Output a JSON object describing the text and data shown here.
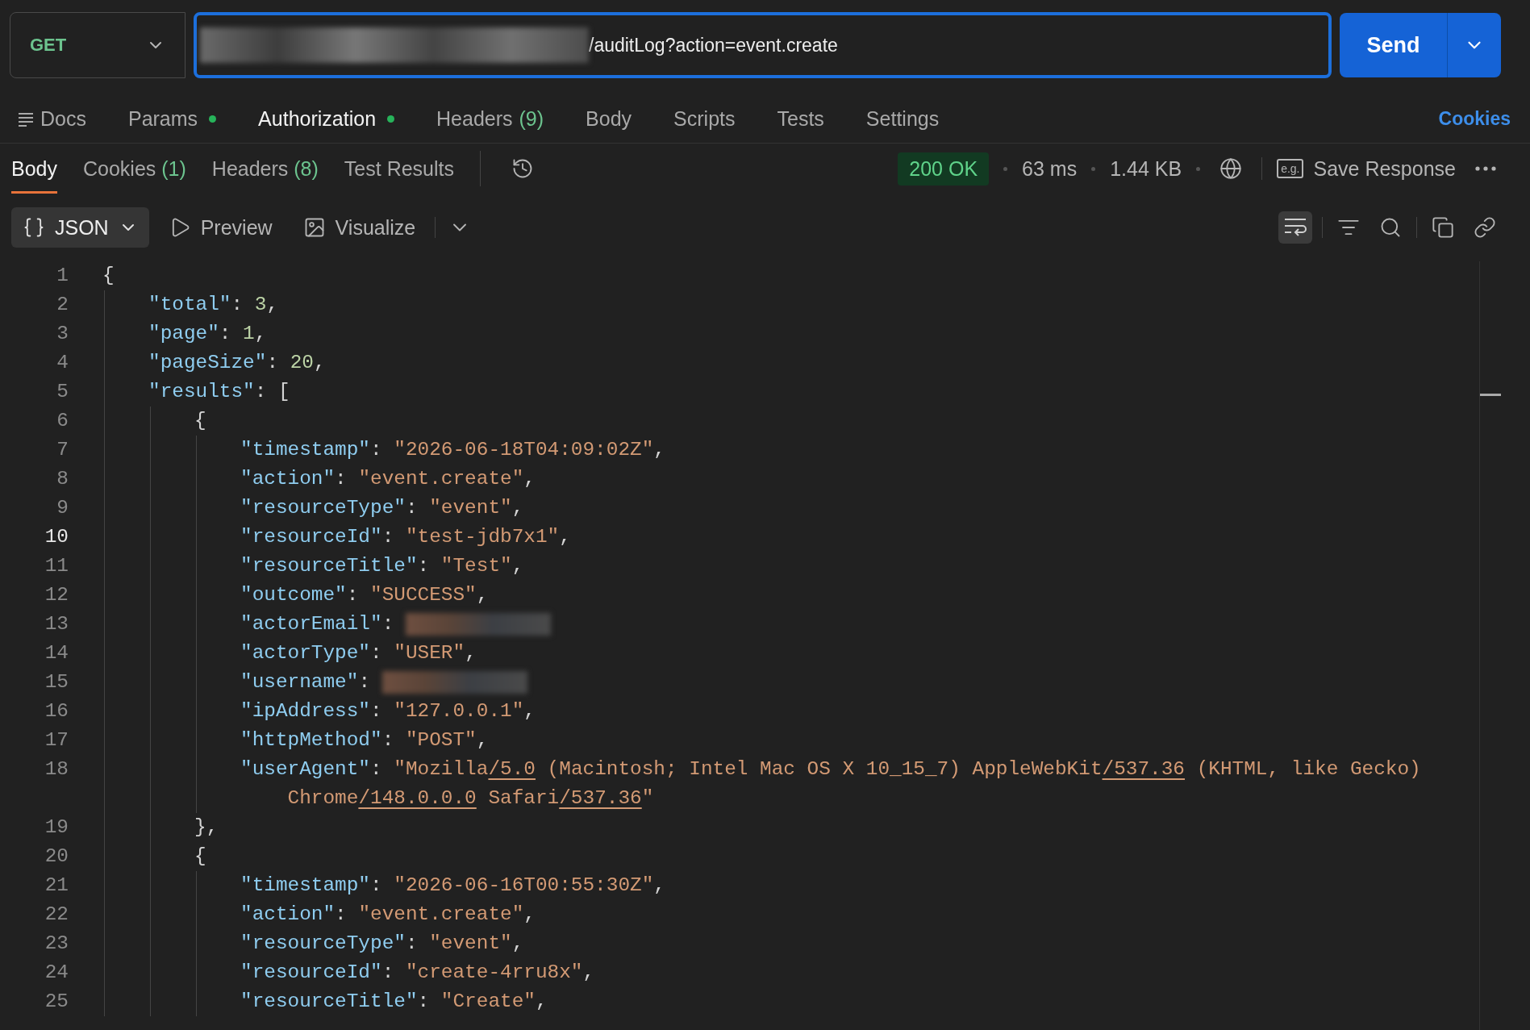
{
  "request": {
    "method": "GET",
    "url": "/auditLog?action=event.create",
    "send": "Send"
  },
  "request_tabs": [
    {
      "label": "Docs",
      "kind": "docs",
      "dot": false,
      "selected": false
    },
    {
      "label": "Params",
      "kind": "plain",
      "dot": true,
      "selected": false
    },
    {
      "label": "Authorization",
      "kind": "plain",
      "dot": true,
      "selected": true
    },
    {
      "label": "Headers",
      "kind": "plain",
      "count": "(9)",
      "dot": false,
      "selected": false
    },
    {
      "label": "Body",
      "kind": "plain",
      "dot": false,
      "selected": false
    },
    {
      "label": "Scripts",
      "kind": "plain",
      "dot": false,
      "selected": false
    },
    {
      "label": "Tests",
      "kind": "plain",
      "dot": false,
      "selected": false
    },
    {
      "label": "Settings",
      "kind": "plain",
      "dot": false,
      "selected": false
    }
  ],
  "cookies_link": "Cookies",
  "response_tabs": [
    {
      "label": "Body",
      "selected": true
    },
    {
      "label": "Cookies",
      "count": "(1)",
      "selected": false
    },
    {
      "label": "Headers",
      "count": "(8)",
      "selected": false
    },
    {
      "label": "Test Results",
      "selected": false
    }
  ],
  "response_meta": {
    "status": "200 OK",
    "time": "63 ms",
    "size": "1.44 KB",
    "example_badge": "e.g.",
    "save": "Save Response"
  },
  "toolbar": {
    "format": "JSON",
    "preview": "Preview",
    "visualize": "Visualize",
    "wrap_on": true
  },
  "code_lines": [
    {
      "number": "1",
      "current": false,
      "tokens": [
        {
          "kind": "punct",
          "text": "{"
        }
      ],
      "children": [
        {
          "number": "2",
          "current": false,
          "tokens": [
            {
              "kind": "key",
              "text": "\"total\""
            },
            {
              "kind": "punct",
              "text": ": "
            },
            {
              "kind": "number",
              "text": "3"
            },
            {
              "kind": "punct",
              "text": ","
            }
          ]
        },
        {
          "number": "3",
          "current": false,
          "tokens": [
            {
              "kind": "key",
              "text": "\"page\""
            },
            {
              "kind": "punct",
              "text": ": "
            },
            {
              "kind": "number",
              "text": "1"
            },
            {
              "kind": "punct",
              "text": ","
            }
          ]
        },
        {
          "number": "4",
          "current": false,
          "tokens": [
            {
              "kind": "key",
              "text": "\"pageSize\""
            },
            {
              "kind": "punct",
              "text": ": "
            },
            {
              "kind": "number",
              "text": "20"
            },
            {
              "kind": "punct",
              "text": ","
            }
          ]
        },
        {
          "number": "5",
          "current": false,
          "tokens": [
            {
              "kind": "key",
              "text": "\"results\""
            },
            {
              "kind": "punct",
              "text": ": ["
            }
          ],
          "children": [
            {
              "number": "6",
              "current": false,
              "tokens": [
                {
                  "kind": "punct",
                  "text": "{"
                }
              ],
              "children": [
                {
                  "number": "7",
                  "current": false,
                  "tokens": [
                    {
                      "kind": "key",
                      "text": "\"timestamp\""
                    },
                    {
                      "kind": "punct",
                      "text": ": "
                    },
                    {
                      "kind": "string",
                      "text": "\"2026-06-18T04:09:02Z\""
                    },
                    {
                      "kind": "punct",
                      "text": ","
                    }
                  ]
                },
                {
                  "number": "8",
                  "current": false,
                  "tokens": [
                    {
                      "kind": "key",
                      "text": "\"action\""
                    },
                    {
                      "kind": "punct",
                      "text": ": "
                    },
                    {
                      "kind": "string",
                      "text": "\"event.create\""
                    },
                    {
                      "kind": "punct",
                      "text": ","
                    }
                  ]
                },
                {
                  "number": "9",
                  "current": false,
                  "tokens": [
                    {
                      "kind": "key",
                      "text": "\"resourceType\""
                    },
                    {
                      "kind": "punct",
                      "text": ": "
                    },
                    {
                      "kind": "string",
                      "text": "\"event\""
                    },
                    {
                      "kind": "punct",
                      "text": ","
                    }
                  ]
                },
                {
                  "number": "10",
                  "current": true,
                  "tokens": [
                    {
                      "kind": "key",
                      "text": "\"resourceId\""
                    },
                    {
                      "kind": "punct",
                      "text": ": "
                    },
                    {
                      "kind": "string",
                      "text": "\"test-jdb7x1\""
                    },
                    {
                      "kind": "punct",
                      "text": ","
                    }
                  ]
                },
                {
                  "number": "11",
                  "current": false,
                  "tokens": [
                    {
                      "kind": "key",
                      "text": "\"resourceTitle\""
                    },
                    {
                      "kind": "punct",
                      "text": ": "
                    },
                    {
                      "kind": "string",
                      "text": "\"Test\""
                    },
                    {
                      "kind": "punct",
                      "text": ","
                    }
                  ]
                },
                {
                  "number": "12",
                  "current": false,
                  "tokens": [
                    {
                      "kind": "key",
                      "text": "\"outcome\""
                    },
                    {
                      "kind": "punct",
                      "text": ": "
                    },
                    {
                      "kind": "string",
                      "text": "\"SUCCESS\""
                    },
                    {
                      "kind": "punct",
                      "text": ","
                    }
                  ]
                },
                {
                  "number": "13",
                  "current": false,
                  "tokens": [
                    {
                      "kind": "key",
                      "text": "\"actorEmail\""
                    },
                    {
                      "kind": "punct",
                      "text": ": "
                    },
                    {
                      "kind": "redacted"
                    }
                  ]
                },
                {
                  "number": "14",
                  "current": false,
                  "tokens": [
                    {
                      "kind": "key",
                      "text": "\"actorType\""
                    },
                    {
                      "kind": "punct",
                      "text": ": "
                    },
                    {
                      "kind": "string",
                      "text": "\"USER\""
                    },
                    {
                      "kind": "punct",
                      "text": ","
                    }
                  ]
                },
                {
                  "number": "15",
                  "current": false,
                  "tokens": [
                    {
                      "kind": "key",
                      "text": "\"username\""
                    },
                    {
                      "kind": "punct",
                      "text": ": "
                    },
                    {
                      "kind": "redacted"
                    }
                  ]
                },
                {
                  "number": "16",
                  "current": false,
                  "tokens": [
                    {
                      "kind": "key",
                      "text": "\"ipAddress\""
                    },
                    {
                      "kind": "punct",
                      "text": ": "
                    },
                    {
                      "kind": "string",
                      "text": "\"127.0.0.1\""
                    },
                    {
                      "kind": "punct",
                      "text": ","
                    }
                  ]
                },
                {
                  "number": "17",
                  "current": false,
                  "tokens": [
                    {
                      "kind": "key",
                      "text": "\"httpMethod\""
                    },
                    {
                      "kind": "punct",
                      "text": ": "
                    },
                    {
                      "kind": "string",
                      "text": "\"POST\""
                    },
                    {
                      "kind": "punct",
                      "text": ","
                    }
                  ]
                },
                {
                  "number": "18",
                  "current": false,
                  "tokens": [
                    {
                      "kind": "key",
                      "text": "\"userAgent\""
                    },
                    {
                      "kind": "punct",
                      "text": ": "
                    },
                    {
                      "kind": "string",
                      "text": "\"Mozilla"
                    },
                    {
                      "kind": "link",
                      "text": "/5.0"
                    },
                    {
                      "kind": "string",
                      "text": " (Macintosh; Intel Mac OS X 10_15_7) AppleWebKit"
                    },
                    {
                      "kind": "link",
                      "text": "/537.36"
                    },
                    {
                      "kind": "string",
                      "text": " (KHTML, like Gecko) Chrome"
                    },
                    {
                      "kind": "link",
                      "text": "/148.0.0.0"
                    },
                    {
                      "kind": "string",
                      "text": " Safari"
                    },
                    {
                      "kind": "link",
                      "text": "/537.36"
                    },
                    {
                      "kind": "string",
                      "text": "\""
                    }
                  ]
                }
              ]
            },
            {
              "number": "19",
              "current": false,
              "tokens": [
                {
                  "kind": "punct",
                  "text": "},"
                }
              ]
            },
            {
              "number": "20",
              "current": false,
              "tokens": [
                {
                  "kind": "punct",
                  "text": "{"
                }
              ],
              "children": [
                {
                  "number": "21",
                  "current": false,
                  "tokens": [
                    {
                      "kind": "key",
                      "text": "\"timestamp\""
                    },
                    {
                      "kind": "punct",
                      "text": ": "
                    },
                    {
                      "kind": "string",
                      "text": "\"2026-06-16T00:55:30Z\""
                    },
                    {
                      "kind": "punct",
                      "text": ","
                    }
                  ]
                },
                {
                  "number": "22",
                  "current": false,
                  "tokens": [
                    {
                      "kind": "key",
                      "text": "\"action\""
                    },
                    {
                      "kind": "punct",
                      "text": ": "
                    },
                    {
                      "kind": "string",
                      "text": "\"event.create\""
                    },
                    {
                      "kind": "punct",
                      "text": ","
                    }
                  ]
                },
                {
                  "number": "23",
                  "current": false,
                  "tokens": [
                    {
                      "kind": "key",
                      "text": "\"resourceType\""
                    },
                    {
                      "kind": "punct",
                      "text": ": "
                    },
                    {
                      "kind": "string",
                      "text": "\"event\""
                    },
                    {
                      "kind": "punct",
                      "text": ","
                    }
                  ]
                },
                {
                  "number": "24",
                  "current": false,
                  "tokens": [
                    {
                      "kind": "key",
                      "text": "\"resourceId\""
                    },
                    {
                      "kind": "punct",
                      "text": ": "
                    },
                    {
                      "kind": "string",
                      "text": "\"create-4rru8x\""
                    },
                    {
                      "kind": "punct",
                      "text": ","
                    }
                  ]
                },
                {
                  "number": "25",
                  "current": false,
                  "tokens": [
                    {
                      "kind": "key",
                      "text": "\"resourceTitle\""
                    },
                    {
                      "kind": "punct",
                      "text": ": "
                    },
                    {
                      "kind": "string",
                      "text": "\"Create\""
                    },
                    {
                      "kind": "punct",
                      "text": ","
                    }
                  ]
                }
              ]
            }
          ]
        }
      ]
    }
  ]
}
